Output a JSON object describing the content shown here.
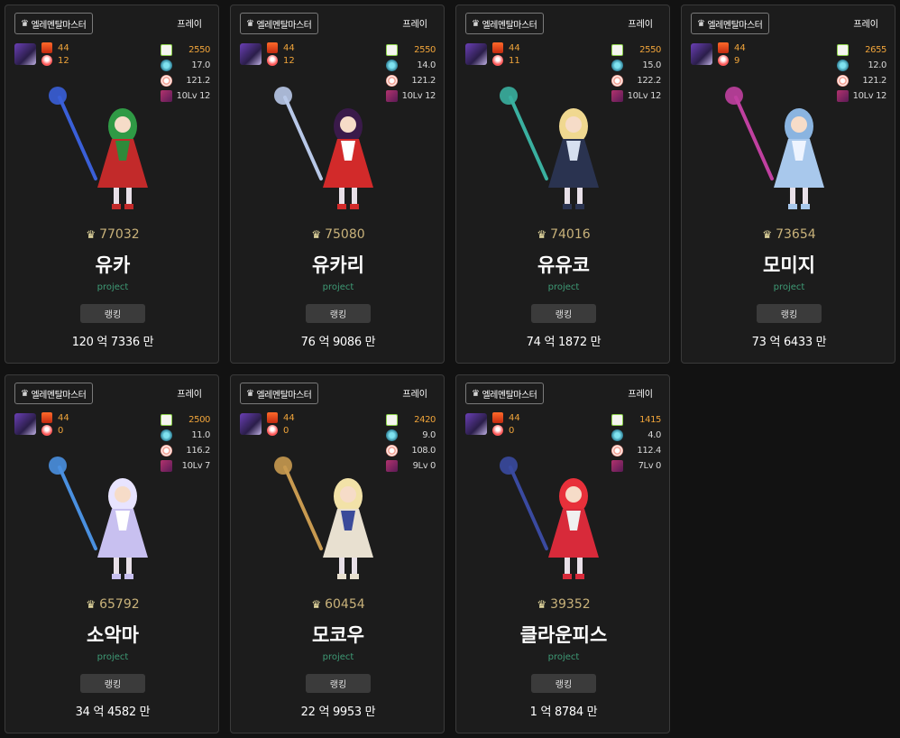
{
  "cards": [
    {
      "job": "엘레멘탈마스터",
      "server": "프레이",
      "badge_top": "44",
      "badge_bottom": "12",
      "stats": [
        "2550",
        "17.0",
        "121.2",
        "10Lv 12"
      ],
      "power": "77032",
      "name": "유카",
      "guild": "project",
      "button": "랭킹",
      "amount": "120 억 7336 만",
      "palette": {
        "main": "#c22a2a",
        "accent": "#2f8a3a",
        "hair": "#2f9a45",
        "weapon": "#3a5fd8"
      }
    },
    {
      "job": "엘레멘탈마스터",
      "server": "프레이",
      "badge_top": "44",
      "badge_bottom": "12",
      "stats": [
        "2550",
        "14.0",
        "121.2",
        "10Lv 12"
      ],
      "power": "75080",
      "name": "유카리",
      "guild": "project",
      "button": "랭킹",
      "amount": "76 억 9086 만",
      "palette": {
        "main": "#d22a2a",
        "accent": "#ffffff",
        "hair": "#3a1a4a",
        "weapon": "#b8c8e8"
      }
    },
    {
      "job": "엘레멘탈마스터",
      "server": "프레이",
      "badge_top": "44",
      "badge_bottom": "11",
      "stats": [
        "2550",
        "15.0",
        "122.2",
        "10Lv 12"
      ],
      "power": "74016",
      "name": "유유코",
      "guild": "project",
      "button": "랭킹",
      "amount": "74 억 1872 만",
      "palette": {
        "main": "#2a3350",
        "accent": "#d6e0f0",
        "hair": "#f0d890",
        "weapon": "#3ab0a0"
      }
    },
    {
      "job": "엘레멘탈마스터",
      "server": "프레이",
      "badge_top": "44",
      "badge_bottom": "9",
      "stats": [
        "2655",
        "12.0",
        "121.2",
        "10Lv 12"
      ],
      "power": "73654",
      "name": "모미지",
      "guild": "project",
      "button": "랭킹",
      "amount": "73 억 6433 만",
      "palette": {
        "main": "#a8c8ec",
        "accent": "#eef4ff",
        "hair": "#8ab4e0",
        "weapon": "#c040a0"
      }
    },
    {
      "job": "엘레멘탈마스터",
      "server": "프레이",
      "badge_top": "44",
      "badge_bottom": "0",
      "stats": [
        "2500",
        "11.0",
        "116.2",
        "10Lv 7"
      ],
      "power": "65792",
      "name": "소악마",
      "guild": "project",
      "button": "랭킹",
      "amount": "34 억 4582 만",
      "palette": {
        "main": "#c8c0f0",
        "accent": "#ffffff",
        "hair": "#e8e4ff",
        "weapon": "#4a90e0"
      }
    },
    {
      "job": "엘레멘탈마스터",
      "server": "프레이",
      "badge_top": "44",
      "badge_bottom": "0",
      "stats": [
        "2420",
        "9.0",
        "108.0",
        "9Lv 0"
      ],
      "power": "60454",
      "name": "모코우",
      "guild": "project",
      "button": "랭킹",
      "amount": "22 억 9953 만",
      "palette": {
        "main": "#e8e0d0",
        "accent": "#3a4a9a",
        "hair": "#f2e2a8",
        "weapon": "#c89a50"
      }
    },
    {
      "job": "엘레멘탈마스터",
      "server": "프레이",
      "badge_top": "44",
      "badge_bottom": "0",
      "stats": [
        "1415",
        "4.0",
        "112.4",
        "7Lv 0"
      ],
      "power": "39352",
      "name": "클라운피스",
      "guild": "project",
      "button": "랭킹",
      "amount": "1 억 8784 만",
      "palette": {
        "main": "#d82a3a",
        "accent": "#f0f0f0",
        "hair": "#e8303a",
        "weapon": "#3a4aa0"
      }
    }
  ]
}
